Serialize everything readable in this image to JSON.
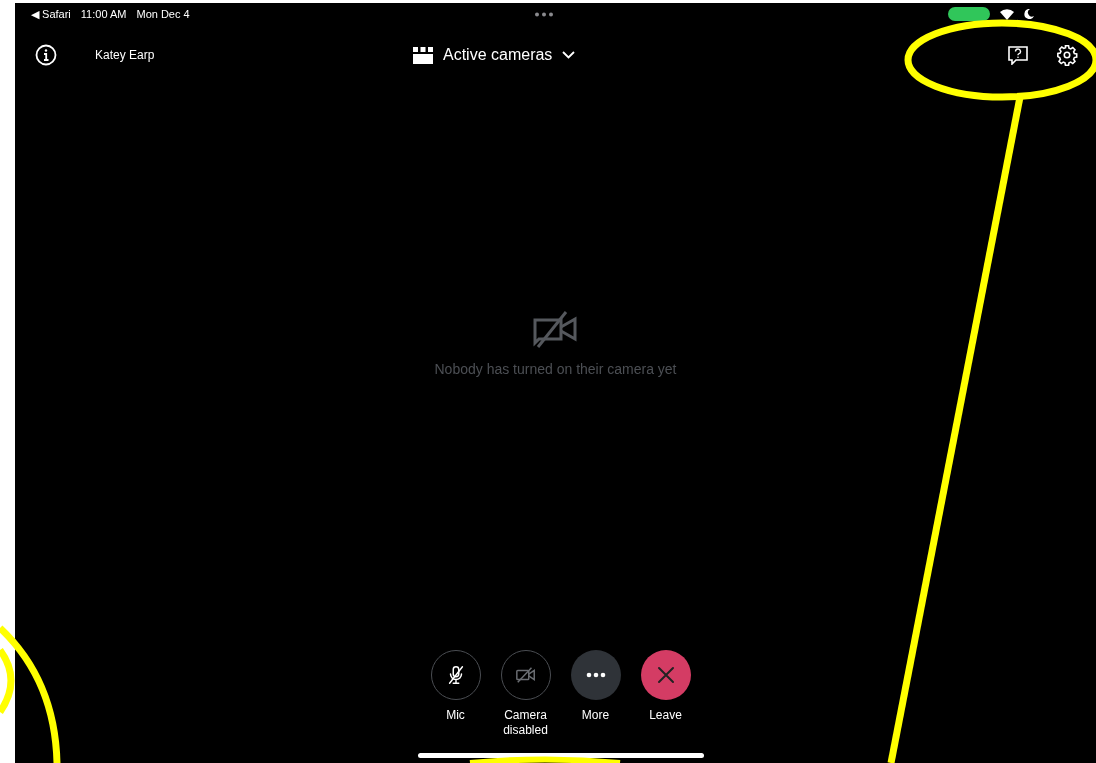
{
  "status_bar": {
    "back_app": "◀ Safari",
    "time": "11:00 AM",
    "date": "Mon Dec 4"
  },
  "header": {
    "user_name": "Katey Earp",
    "view_selector": {
      "label": "Active cameras"
    }
  },
  "empty_state": {
    "message": "Nobody has turned on their camera yet"
  },
  "controls": [
    {
      "kind": "mic",
      "label": "Mic",
      "muted": true
    },
    {
      "kind": "camera",
      "label": "Camera disabled",
      "disabled": true
    },
    {
      "kind": "more",
      "label": "More"
    },
    {
      "kind": "leave",
      "label": "Leave"
    }
  ]
}
